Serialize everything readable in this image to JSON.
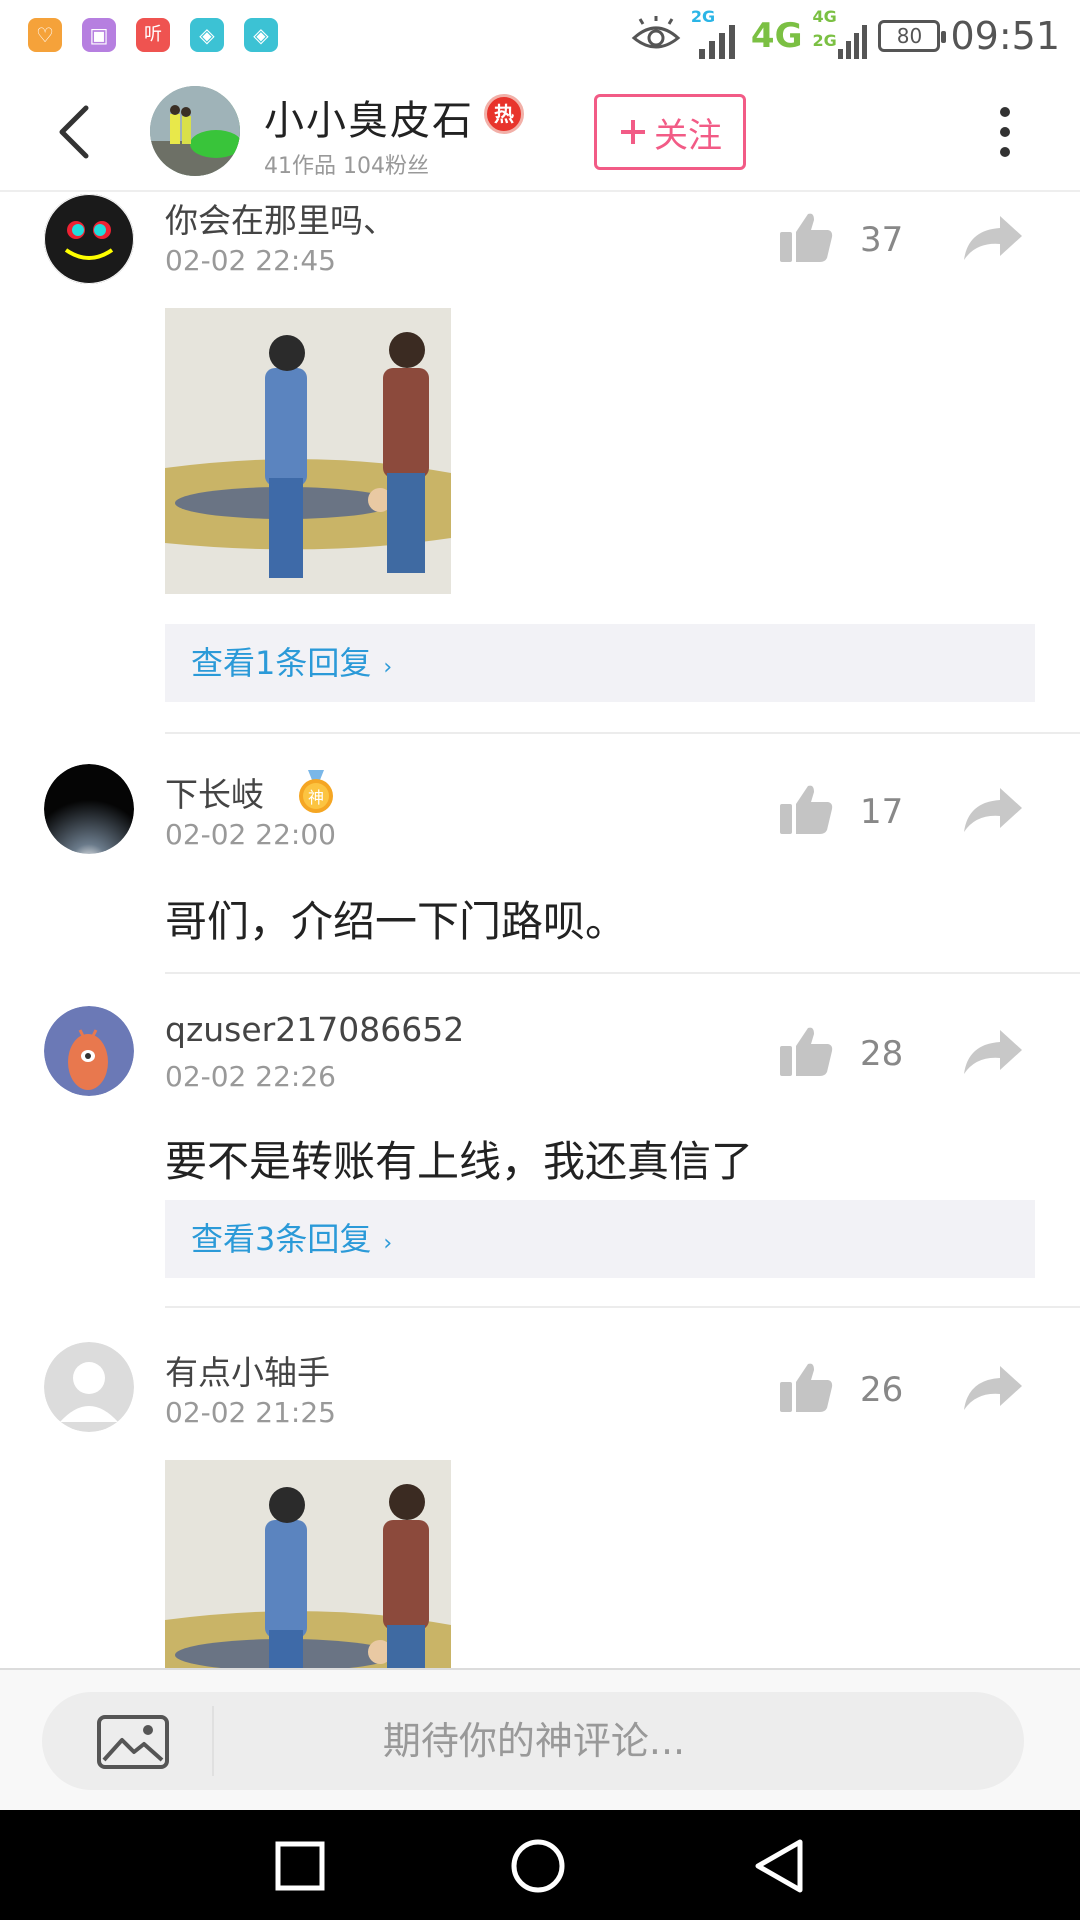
{
  "status_bar": {
    "time": "09:51",
    "battery": "80",
    "network_main": "4G",
    "network_sub_top": "2G",
    "network_sub_a": "4G",
    "network_sub_b": "2G",
    "app_icons": [
      {
        "name": "heart-app-icon",
        "color": "#f5a23a",
        "glyph": "♡"
      },
      {
        "name": "gallery-app-icon",
        "color": "#b67fe0",
        "glyph": "▣"
      },
      {
        "name": "listen-app-icon",
        "color": "#ef5350",
        "glyph": "听"
      },
      {
        "name": "shield-app-icon-1",
        "color": "#3cc2d4",
        "glyph": "◈"
      },
      {
        "name": "shield-app-icon-2",
        "color": "#3cc2d4",
        "glyph": "◈"
      }
    ]
  },
  "header": {
    "name": "小小臭皮石",
    "hot_badge": "热",
    "stats": "41作品  104粉丝",
    "follow_label": "关注"
  },
  "comments": [
    {
      "name": "你会在那里吗、",
      "time": "02-02 22:45",
      "likes": "37",
      "reply_label": "查看1条回复"
    },
    {
      "name": "下长岐",
      "time": "02-02 22:00",
      "likes": "17",
      "badge": "神",
      "text": "哥们，介绍一下门路呗。"
    },
    {
      "name": "qzuser217086652",
      "time": "02-02 22:26",
      "likes": "28",
      "text": "要不是转账有上线，我还真信了",
      "reply_label": "查看3条回复"
    },
    {
      "name": "有点小轴手",
      "time": "02-02 21:25",
      "likes": "26"
    }
  ],
  "input": {
    "placeholder": "期待你的神评论..."
  },
  "colors": {
    "accent_pink": "#f25b86",
    "link_blue": "#2b9ad8",
    "hot_red": "#e8342c",
    "badge_gold": "#f5a623"
  }
}
